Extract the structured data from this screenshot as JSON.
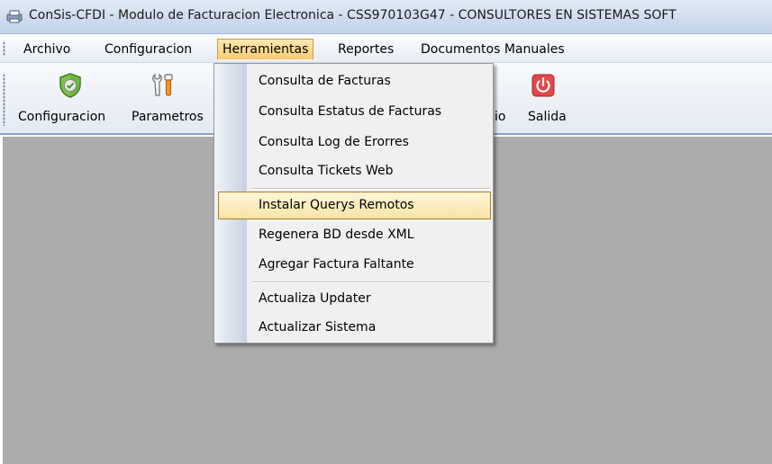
{
  "window": {
    "title": "ConSis-CFDI - Modulo de Facturacion Electronica - CSS970103G47 - CONSULTORES EN SISTEMAS SOFT"
  },
  "menubar": {
    "items": [
      {
        "label": "Archivo"
      },
      {
        "label": "Configuracion"
      },
      {
        "label": "Herramientas",
        "open": true
      },
      {
        "label": "Reportes"
      },
      {
        "label": "Documentos Manuales"
      }
    ]
  },
  "toolbar": {
    "buttons": [
      {
        "label": "Configuracion",
        "icon": "shield-check-icon"
      },
      {
        "label": "Parametros",
        "icon": "tools-icon"
      },
      {
        "label": "io",
        "icon": "partial-icon"
      },
      {
        "label": "Salida",
        "icon": "power-icon"
      }
    ]
  },
  "dropdown": {
    "items": [
      {
        "label": "Consulta de Facturas"
      },
      {
        "label": "Consulta Estatus de Facturas"
      },
      {
        "label": "Consulta Log de Erorres"
      },
      {
        "label": "Consulta Tickets Web"
      },
      {
        "label": "Instalar Querys Remotos",
        "highlighted": true
      },
      {
        "label": "Regenera BD desde XML"
      },
      {
        "label": "Agregar Factura Faltante"
      },
      {
        "label": "Actualiza Updater"
      },
      {
        "label": "Actualizar Sistema"
      }
    ]
  },
  "colors": {
    "workspace": "#ababab",
    "menu_open": "#f7cd71",
    "menu_highlight": "#f9e3a6",
    "exit_red": "#e0484a"
  }
}
